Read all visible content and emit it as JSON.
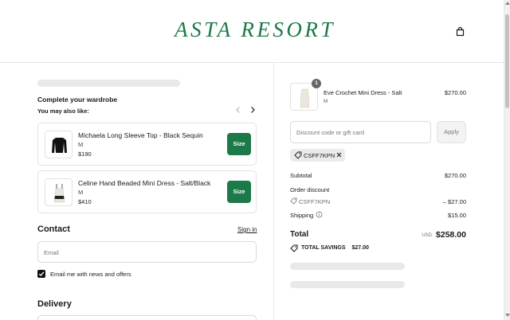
{
  "header": {
    "brand": "ASTA RESORT",
    "cart_icon": "shopping-bag-icon"
  },
  "recommendations": {
    "title": "Complete your wardrobe",
    "subtitle": "You may also like:",
    "items": [
      {
        "name": "Michaela Long Sleeve Top - Black Sequin",
        "variant": "M",
        "price": "$190",
        "button": "Size"
      },
      {
        "name": "Celine Hand Beaded Mini Dress - Salt/Black",
        "variant": "M",
        "price": "$410",
        "button": "Size"
      }
    ]
  },
  "contact": {
    "title": "Contact",
    "signin_link": "Sign in",
    "email_placeholder": "Email",
    "newsletter_label": "Email me with news and offers",
    "newsletter_checked": true
  },
  "delivery": {
    "title": "Delivery"
  },
  "order": {
    "item": {
      "name": "Eve Crochet Mini Dress - Salt",
      "variant": "M",
      "price": "$270.00",
      "quantity": "1"
    },
    "discount_placeholder": "Discount code or gift card",
    "apply_label": "Apply",
    "applied_code": "CSFF7KPN",
    "subtotal_label": "Subtotal",
    "subtotal_value": "$270.00",
    "discount_label": "Order discount",
    "discount_code": "CSFF7KPN",
    "discount_value": "– $27.00",
    "shipping_label": "Shipping",
    "shipping_value": "$15.00",
    "total_label": "Total",
    "total_currency": "USD",
    "total_value": "$258.00",
    "savings_label": "TOTAL SAVINGS",
    "savings_value": "$27.00"
  },
  "colors": {
    "brand": "#1b7a48",
    "skeleton": "#e9e9e9"
  }
}
